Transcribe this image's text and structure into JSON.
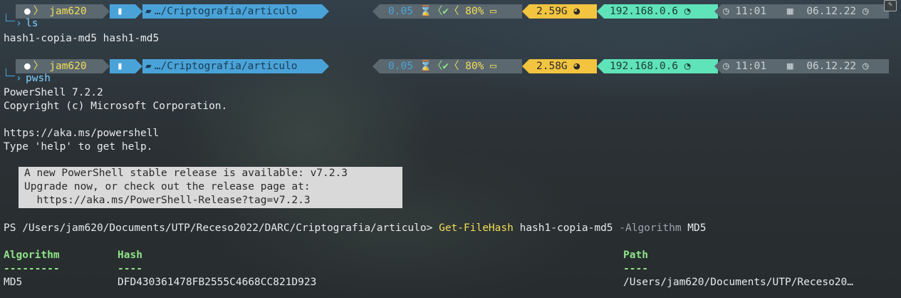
{
  "prompt1": {
    "user": "jam620",
    "path": "…/Criptografia/articulo",
    "load": "0.05",
    "battery": "80%",
    "memory": "2.59G",
    "ip": "192.168.0.6",
    "time": "11:01",
    "date": "06.12.22",
    "command": "ls"
  },
  "ls_output": "hash1-copia-md5 hash1-md5",
  "prompt2": {
    "user": "jam620",
    "path": "…/Criptografia/articulo",
    "load": "0.05",
    "battery": "80%",
    "memory": "2.58G",
    "ip": "192.168.0.6",
    "time": "11:01",
    "date": "06.12.22",
    "command": "pwsh"
  },
  "pwsh_banner": {
    "version": "PowerShell 7.2.2",
    "copyright": "Copyright (c) Microsoft Corporation.",
    "url": "https://aka.ms/powershell",
    "help": "Type 'help' to get help."
  },
  "notice": {
    "line1": "A new PowerShell stable release is available: v7.2.3",
    "line2": "Upgrade now, or check out the release page at:",
    "line3": "  https://aka.ms/PowerShell-Release?tag=v7.2.3"
  },
  "ps_prompt": {
    "prefix": "PS /Users/jam620/Documents/UTP/Receso2022/DARC/Criptografia/articulo> ",
    "cmdlet": "Get-FileHash",
    "arg": " hash1-copia-md5 ",
    "param": "-Algorithm",
    "value": " MD5"
  },
  "table": {
    "headers": [
      "Algorithm",
      "Hash",
      "Path"
    ],
    "dashes": [
      "---------",
      "----",
      "----"
    ],
    "rows": [
      [
        "MD5",
        "DFD430361478FB2555C4668CC821D923",
        "/Users/jam620/Documents/UTP/Receso20…"
      ]
    ]
  },
  "icons": {
    "apple": "apple-icon",
    "battery_small": "battery-icon",
    "folder": "folder-icon",
    "hourglass": "hourglass-icon",
    "check": "check-icon",
    "drive": "drive-icon",
    "gauge": "gauge-icon",
    "wifi": "wifi-icon",
    "clock": "clock-icon",
    "calendar": "calendar-icon"
  },
  "colors": {
    "user_seg": "#5b6870",
    "user_text": "#f3dd58",
    "path_seg": "#4aa3d8",
    "status_seg": "#5b6870",
    "load_text": "#4aa3d8",
    "check_text": "#8fe388",
    "battery_text": "#f3dd58",
    "mem_seg": "#f3c440",
    "ip_seg": "#5fe3b8",
    "time_seg": "#5b6870"
  }
}
